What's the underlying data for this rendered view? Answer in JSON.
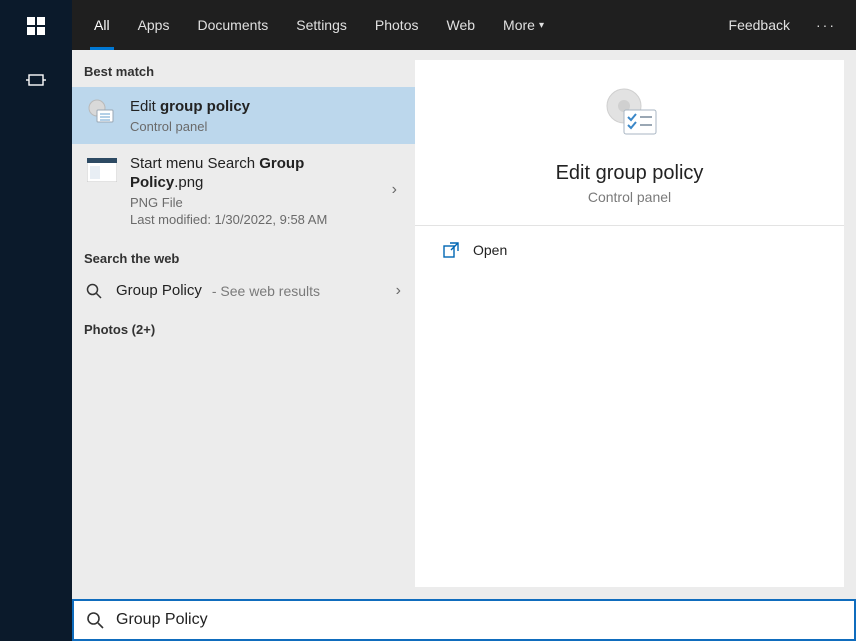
{
  "tabs": {
    "all": "All",
    "apps": "Apps",
    "documents": "Documents",
    "settings": "Settings",
    "photos": "Photos",
    "web": "Web",
    "more": "More",
    "feedback": "Feedback"
  },
  "sections": {
    "best_match": "Best match",
    "search_web": "Search the web",
    "photos_header": "Photos (2+)"
  },
  "results": {
    "edit_gp": {
      "title_pre": "Edit ",
      "title_bold": "group policy",
      "subtitle": "Control panel"
    },
    "png": {
      "title_pre": "Start menu Search ",
      "title_bold": "Group Policy",
      "title_post": ".png",
      "type_line": "PNG File",
      "modified_line": "Last modified: 1/30/2022, 9:58 AM"
    },
    "web": {
      "query": "Group Policy",
      "tail": " - See web results"
    }
  },
  "detail": {
    "title": "Edit group policy",
    "subtitle": "Control panel",
    "action_open": "Open"
  },
  "search": {
    "value": "Group Policy"
  }
}
